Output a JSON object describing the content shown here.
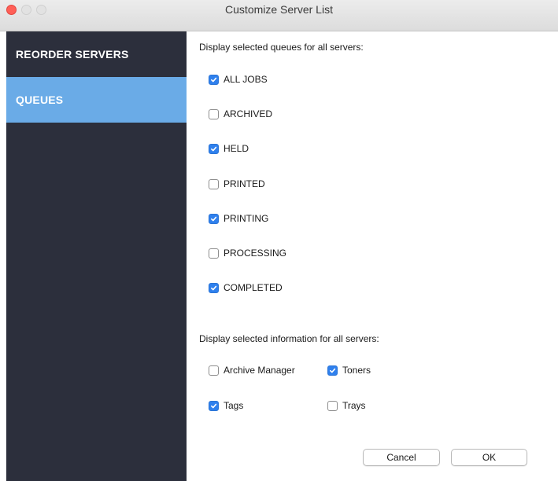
{
  "window": {
    "title": "Customize Server List"
  },
  "sidebar": {
    "items": [
      {
        "label": "REORDER SERVERS",
        "selected": false
      },
      {
        "label": "QUEUES",
        "selected": true
      }
    ]
  },
  "queues": {
    "heading": "Display selected queues for all servers:",
    "items": [
      {
        "label": "ALL JOBS",
        "checked": true
      },
      {
        "label": "ARCHIVED",
        "checked": false
      },
      {
        "label": "HELD",
        "checked": true
      },
      {
        "label": "PRINTED",
        "checked": false
      },
      {
        "label": "PRINTING",
        "checked": true
      },
      {
        "label": "PROCESSING",
        "checked": false
      },
      {
        "label": "COMPLETED",
        "checked": true
      }
    ]
  },
  "info": {
    "heading": "Display selected information for all servers:",
    "items": [
      {
        "label": "Archive Manager",
        "checked": false
      },
      {
        "label": "Toners",
        "checked": true
      },
      {
        "label": "Tags",
        "checked": true
      },
      {
        "label": "Trays",
        "checked": false
      }
    ]
  },
  "buttons": {
    "cancel": "Cancel",
    "ok": "OK"
  },
  "colors": {
    "sidebar_bg": "#2c2f3c",
    "selected_item_bg": "#6aabe7",
    "checkbox_checked": "#2f80ed",
    "close_button": "#ff5f57"
  }
}
